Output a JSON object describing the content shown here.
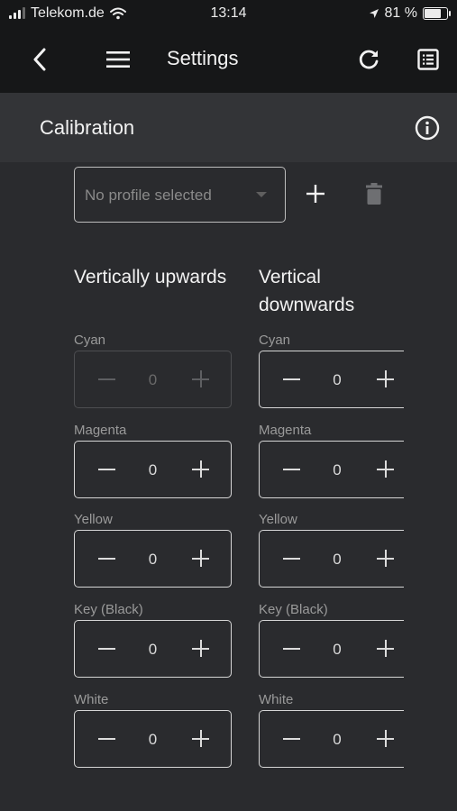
{
  "status_bar": {
    "carrier": "Telekom.de",
    "time": "13:14",
    "battery": "81 %",
    "battery_level": 0.81,
    "signal_bars": 3
  },
  "app_bar": {
    "title": "Settings",
    "icons": [
      "back-chevron-icon",
      "hamburger-menu-icon",
      "refresh-icon",
      "list-document-icon"
    ]
  },
  "section": {
    "title": "Calibration",
    "icon": "info-icon"
  },
  "profile": {
    "placeholder": "No profile selected",
    "add_icon": "plus-icon",
    "delete_icon": "trash-icon"
  },
  "columns": {
    "left": {
      "heading": "Vertically upwards",
      "fields": [
        {
          "label": "Cyan",
          "value": "0",
          "disabled": true
        },
        {
          "label": "Magenta",
          "value": "0"
        },
        {
          "label": "Yellow",
          "value": "0"
        },
        {
          "label": "Key (Black)",
          "value": "0"
        },
        {
          "label": "White",
          "value": "0"
        }
      ]
    },
    "right": {
      "heading_line1": "Vertical",
      "heading_line2": "downwards",
      "fields": [
        {
          "label": "Cyan",
          "value": "0"
        },
        {
          "label": "Magenta",
          "value": "0"
        },
        {
          "label": "Yellow",
          "value": "0"
        },
        {
          "label": "Key (Black)",
          "value": "0"
        },
        {
          "label": "White",
          "value": "0"
        }
      ]
    }
  },
  "colors": {
    "background": "#2a2b2e",
    "app_bar": "#161718",
    "section_header": "#333437",
    "text": "#ececec"
  }
}
